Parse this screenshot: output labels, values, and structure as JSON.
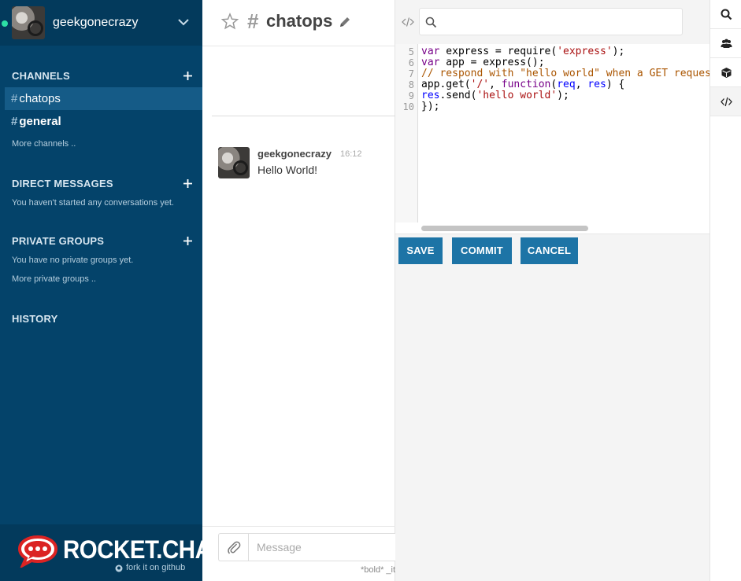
{
  "account": {
    "username": "geekgonecrazy",
    "status_color": "#2de0a5"
  },
  "sidebar": {
    "channels_title": "CHANNELS",
    "channels": [
      {
        "name": "chatops",
        "active": true,
        "unread": false
      },
      {
        "name": "general",
        "active": false,
        "unread": true
      }
    ],
    "more_channels": "More channels ..",
    "dm_title": "DIRECT MESSAGES",
    "dm_empty": "You haven't started any conversations yet.",
    "groups_title": "PRIVATE GROUPS",
    "groups_empty": "You have no private groups yet.",
    "more_groups": "More private groups ..",
    "history_title": "HISTORY",
    "hash_symbol": "#"
  },
  "footer": {
    "brand": "ROCKET.CHAT",
    "fork": "fork it on github"
  },
  "room": {
    "hash": "#",
    "name": "chatops",
    "messages": [
      {
        "user": "geekgonecrazy",
        "time": "16:12",
        "text": "Hello World!"
      }
    ],
    "composer_placeholder": "Message",
    "format_hint": "*bold* _italics_"
  },
  "code_panel": {
    "search_placeholder": "",
    "lines": [
      {
        "num": "5",
        "text": "var express = require('express');"
      },
      {
        "num": "6",
        "text": "var app = express();"
      },
      {
        "num": "7",
        "text": "// respond with \"hello world\" when a GET request"
      },
      {
        "num": "8",
        "text": "app.get('/', function(req, res) {"
      },
      {
        "num": "9",
        "text": "res.send('hello world');"
      },
      {
        "num": "10",
        "text": "});"
      }
    ],
    "buttons": {
      "save": "SAVE",
      "commit": "COMMIT",
      "cancel": "CANCEL"
    },
    "button_color": "#1d74a6"
  },
  "right_toolbar": {
    "items": [
      {
        "icon": "search-icon"
      },
      {
        "icon": "users-icon"
      },
      {
        "icon": "cube-icon"
      },
      {
        "icon": "code-icon",
        "active": true
      }
    ]
  },
  "colors": {
    "sidebar_bg": "#04436a",
    "sidebar_active": "#155b87",
    "accent": "#1d74a6"
  }
}
